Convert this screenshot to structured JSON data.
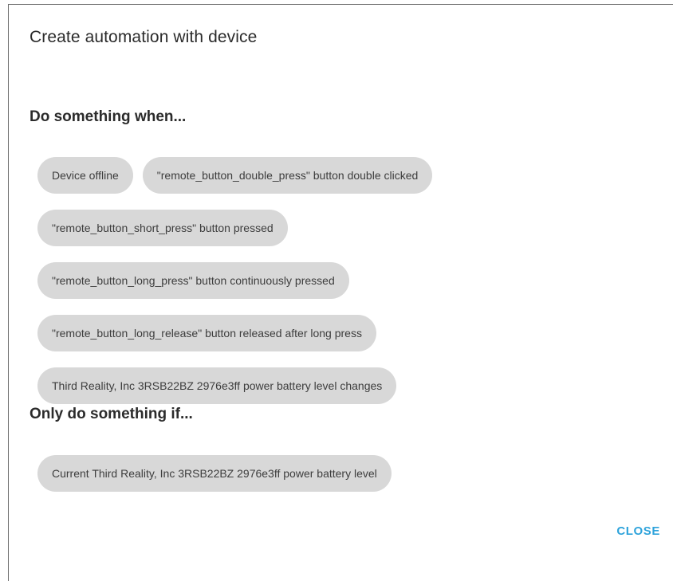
{
  "dialog": {
    "title": "Create automation with device",
    "close_label": "CLOSE"
  },
  "triggers": {
    "heading": "Do something when...",
    "chips": [
      "Device offline",
      "\"remote_button_double_press\" button double clicked",
      "\"remote_button_short_press\" button pressed",
      "\"remote_button_long_press\" button continuously pressed",
      "\"remote_button_long_release\" button released after long press",
      "Third Reality, Inc 3RSB22BZ 2976e3ff power battery level changes"
    ]
  },
  "conditions": {
    "heading": "Only do something if...",
    "chips": [
      "Current Third Reality, Inc 3RSB22BZ 2976e3ff power battery level"
    ]
  },
  "colors": {
    "chip_background": "#d8d8d8",
    "accent": "#2ea3db",
    "text": "#2b2b2b"
  }
}
